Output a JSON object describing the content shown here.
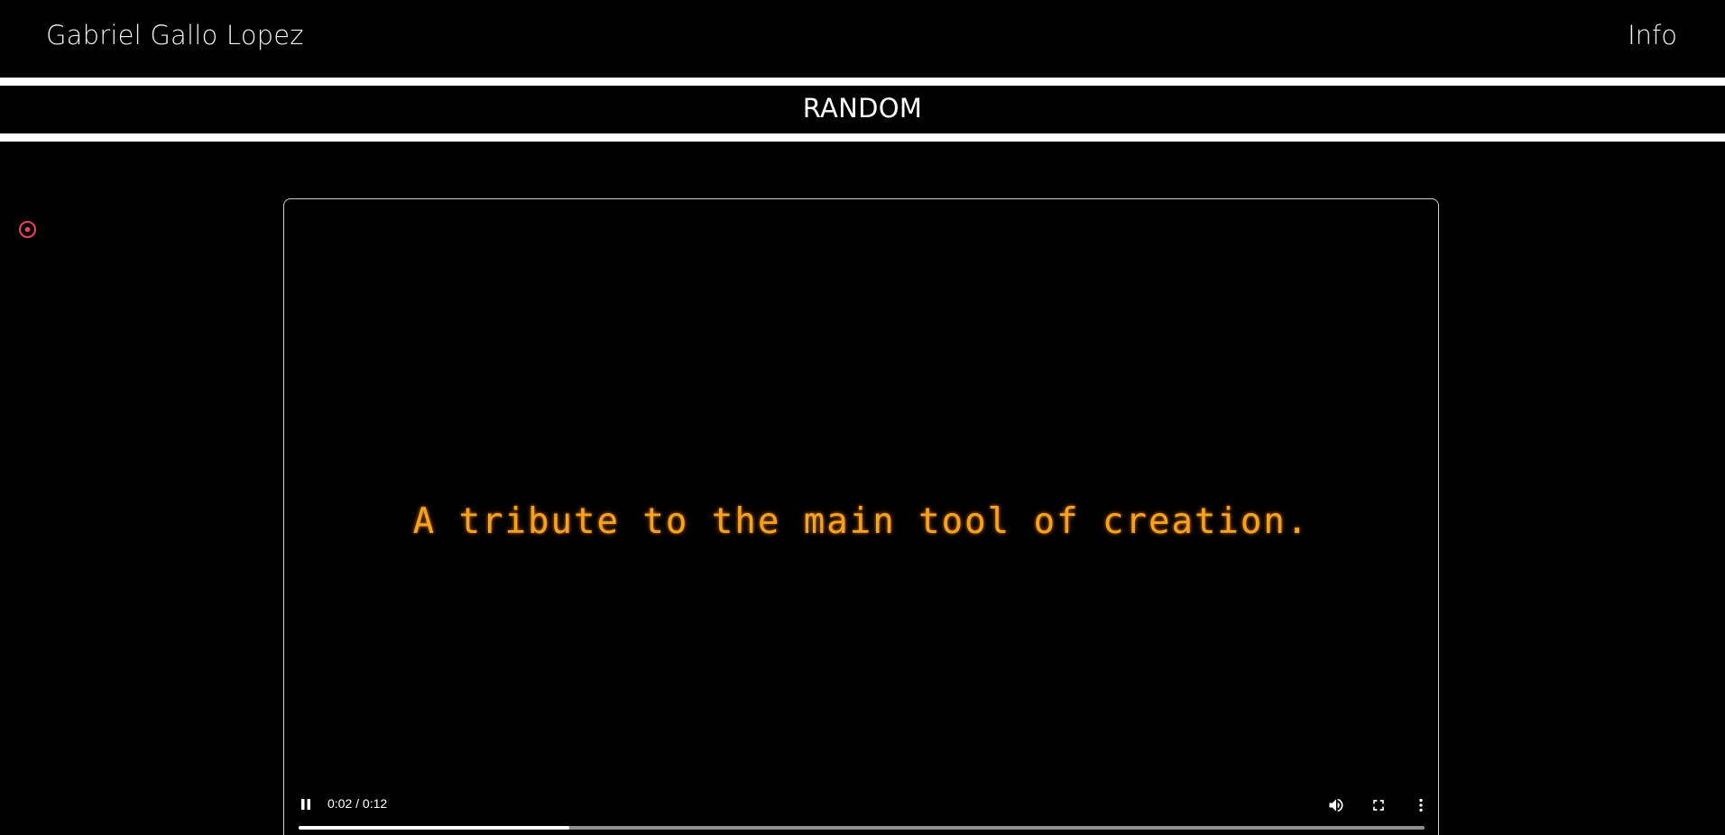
{
  "header": {
    "site_title": "Gabriel Gallo Lopez",
    "info_link": "Info"
  },
  "section": {
    "title": "RANDOM"
  },
  "sidebar": {
    "icon": "target-icon",
    "icon_color": "#e8455a"
  },
  "video": {
    "caption": "A tribute to the main tool of creation.",
    "caption_color": "#f5a326",
    "state": "playing",
    "current_time": "0:02",
    "duration": "0:12",
    "time_display": "0:02 / 0:12",
    "progress_fraction": 0.24,
    "controls": {
      "play_pause_icon": "pause-icon",
      "volume_icon": "volume-icon",
      "fullscreen_icon": "fullscreen-icon",
      "more_icon": "more-options-icon"
    }
  }
}
